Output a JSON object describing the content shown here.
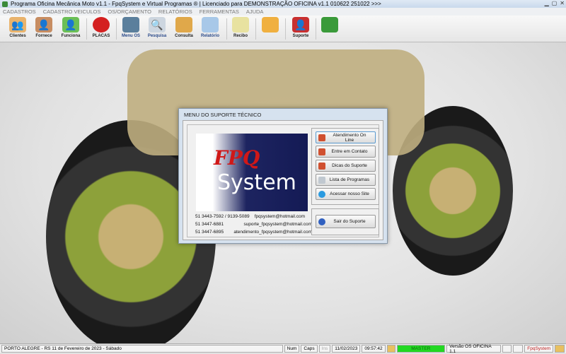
{
  "window": {
    "title": "Programa Oficina Mecânica Moto v1.1 - FpqSystem e Virtual Programas ® | Licenciado para  DEMONSTRAÇÃO OFICINA v1.1 010622 251022 >>>"
  },
  "menu": [
    "CADASTROS",
    "CADASTRO VEICULOS",
    "OS/ORÇAMENTO",
    "RELATÓRIOS",
    "FERRAMENTAS",
    "AJUDA"
  ],
  "toolbar": [
    {
      "label": "Clientes",
      "icon": "clients-icon"
    },
    {
      "label": "Fornece",
      "icon": "supplier-icon"
    },
    {
      "label": "Funciona",
      "icon": "employee-icon"
    },
    {
      "label": "PLACAS",
      "icon": "plates-icon"
    },
    {
      "label": "Menu OS",
      "icon": "clipboard-icon"
    },
    {
      "label": "Pesquisa",
      "icon": "search-icon"
    },
    {
      "label": "Consulta",
      "icon": "folder-icon"
    },
    {
      "label": "Relatório",
      "icon": "printer-icon"
    },
    {
      "label": "Recibo",
      "icon": "receipt-icon"
    },
    {
      "label": "",
      "icon": "calculator-icon"
    },
    {
      "label": "Suporte",
      "icon": "support-icon"
    },
    {
      "label": "",
      "icon": "exit-icon"
    }
  ],
  "dialog": {
    "title": "MENU DO SUPORTE TÉCNICO",
    "logo": {
      "top": "FPQ",
      "bottom": "System"
    },
    "contacts": [
      {
        "phone": "51 3443-7592 / 9139-5089",
        "email": "fpqsystem@hotmail.com"
      },
      {
        "phone": "51 3447-6881",
        "email": "suporte_fpqsystem@hotmail.com"
      },
      {
        "phone": "51 3447-6895",
        "email": "atendimento_fpqsystem@hotmail.com"
      }
    ],
    "buttons": [
      "Atendimento On Line",
      "Entre em Contato",
      "Dicas do Suporte",
      "Lista de Programas",
      "Acessar nosso Site"
    ],
    "exit": "Sair do Suporte"
  },
  "status": {
    "location": "PORTO ALEGRE - RS 11 de Fevereiro de 2023 - Sábado",
    "num": "Num",
    "caps": "Caps",
    "ins": "Ins",
    "date": "11/02/2023",
    "time": "09:57:42",
    "user": "MASTER",
    "version": "Versão OS OFICINA 1.1",
    "brand": "FpqSystem"
  }
}
